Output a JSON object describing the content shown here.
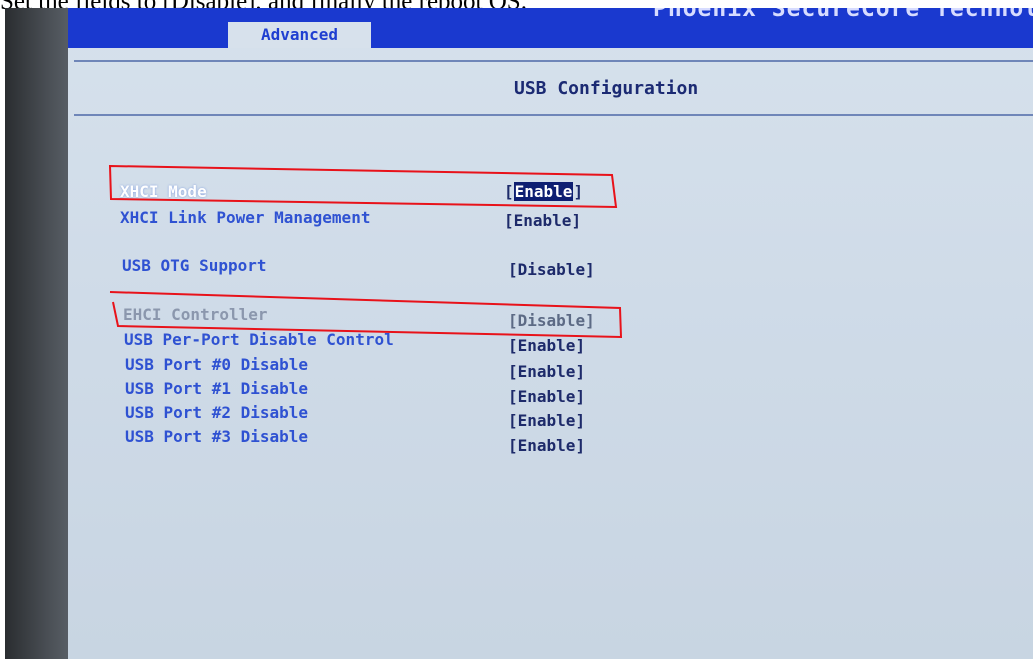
{
  "caption": {
    "text": "Set the fields to [Disable], and finally the reboot OS."
  },
  "bios": {
    "brand": "Phoenix SecureCore Technology",
    "tab_active": "Advanced",
    "page_title": "USB Configuration",
    "accent_color": "#1a39cf",
    "background_color": "#d2dde9",
    "items": [
      {
        "label": "XHCI Mode",
        "value": "Enable"
      },
      {
        "label": "XHCI Link Power Management",
        "value": "Enable"
      },
      {
        "label": "USB OTG Support",
        "value": "Disable"
      },
      {
        "label": "EHCI Controller",
        "value": "Disable"
      },
      {
        "label": "USB Per-Port Disable Control",
        "value": "Enable"
      },
      {
        "label": "USB Port #0 Disable",
        "value": "Enable"
      },
      {
        "label": "USB Port #1 Disable",
        "value": "Enable"
      },
      {
        "label": "USB Port #2 Disable",
        "value": "Enable"
      },
      {
        "label": "USB Port #3 Disable",
        "value": "Enable"
      }
    ]
  },
  "annotations": {
    "highlight_color": "#e8121a",
    "highlighted_items": [
      "XHCI Mode",
      "EHCI Controller"
    ]
  }
}
